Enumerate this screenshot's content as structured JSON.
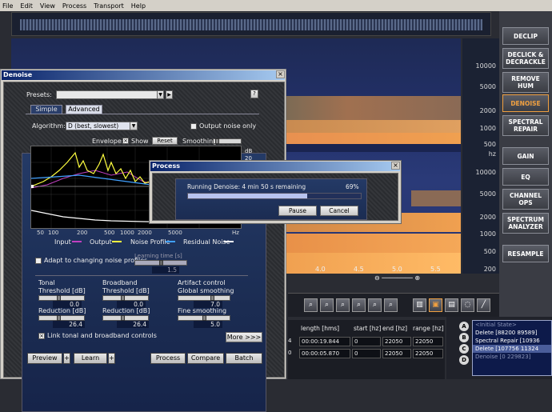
{
  "menu": [
    "File",
    "Edit",
    "View",
    "Process",
    "Transport",
    "Help"
  ],
  "hz_labels": [
    {
      "text": "10000",
      "top": 30
    },
    {
      "text": "5000",
      "top": 56
    },
    {
      "text": "2000",
      "top": 86
    },
    {
      "text": "1000",
      "top": 108
    },
    {
      "text": "500",
      "top": 128
    },
    {
      "text": "hz",
      "top": 140
    },
    {
      "text": "10000",
      "top": 163
    },
    {
      "text": "5000",
      "top": 190
    },
    {
      "text": "2000",
      "top": 219
    },
    {
      "text": "1000",
      "top": 240
    },
    {
      "text": "500",
      "top": 262
    },
    {
      "text": "200",
      "top": 284
    }
  ],
  "modules": [
    "DECLIP",
    "DECLICK & DECRACKLE",
    "REMOVE HUM",
    "DENOISE",
    "SPECTRAL REPAIR",
    "GAIN",
    "EQ",
    "CHANNEL OPS",
    "SPECTRUM ANALYZER",
    "RESAMPLE"
  ],
  "time_axis": [
    "4.0",
    "4.5",
    "5.0",
    "5.5"
  ],
  "table": {
    "headers": [
      "length [hms]",
      "start [hz]",
      "end [hz]",
      "range [hz]"
    ],
    "rows": [
      {
        "c0": "4",
        "length": "00:00:19.844",
        "start": "0",
        "end": "22050",
        "range": "22050"
      },
      {
        "c0": "0",
        "length": "00:00:05.870",
        "start": "0",
        "end": "22050",
        "range": "22050"
      }
    ]
  },
  "history": {
    "letters": [
      "A",
      "B",
      "C",
      "D"
    ],
    "items": [
      "<Initial State>",
      "Delete [88200 89589]",
      "Spectral Repair [10936",
      "Delete [107756 11324",
      "Denoise [0 229823]"
    ]
  },
  "denoise": {
    "title": "Denoise",
    "presets_label": "Presets:",
    "help": "?",
    "tabs": [
      "Simple",
      "Advanced"
    ],
    "algorithm_label": "Algorithm:",
    "algorithm_value": "D (best, slowest)",
    "output_noise_only": "Output noise only",
    "envelope_label": "Envelope:",
    "show_label": "Show",
    "reset_label": "Reset",
    "smoothing_label": "Smoothing",
    "db_label": "dB",
    "db_ticks": [
      "20"
    ],
    "x_ticks": [
      "50",
      "100",
      "200",
      "500",
      "1000",
      "2000",
      "5000"
    ],
    "x_trunc": "Hz",
    "legend": [
      "Input",
      "Output",
      "Noise Profile",
      "Residual Noise"
    ],
    "legend_colors": [
      "#c040c0",
      "#ffff40",
      "#40a0ff",
      "#ffffff"
    ],
    "adapt_label": "Adapt to changing noise profiles",
    "learning_time_label": "Learning time [s]",
    "learning_time_value": "1.5",
    "groups": {
      "tonal": {
        "title": "Tonal",
        "threshold": "Threshold [dB]",
        "threshold_val": "0.0",
        "reduction": "Reduction [dB]",
        "reduction_val": "26.4"
      },
      "broadband": {
        "title": "Broadband",
        "threshold": "Threshold [dB]",
        "threshold_val": "0.0",
        "reduction": "Reduction [dB]",
        "reduction_val": "26.4"
      },
      "artifact": {
        "title": "Artifact control",
        "global": "Global smoothing",
        "global_val": "7.0",
        "fine": "Fine smoothing",
        "fine_val": "5.0"
      }
    },
    "link_label": "Link tonal and broadband controls",
    "more_label": "More >>>",
    "buttons": [
      "Preview",
      "Learn",
      "Process",
      "Compare",
      "Batch"
    ]
  },
  "process": {
    "title": "Process",
    "status": "Running Denoise:  4 min 50 s remaining",
    "percent": "69%",
    "progress": 0.69,
    "pause": "Pause",
    "cancel": "Cancel"
  }
}
